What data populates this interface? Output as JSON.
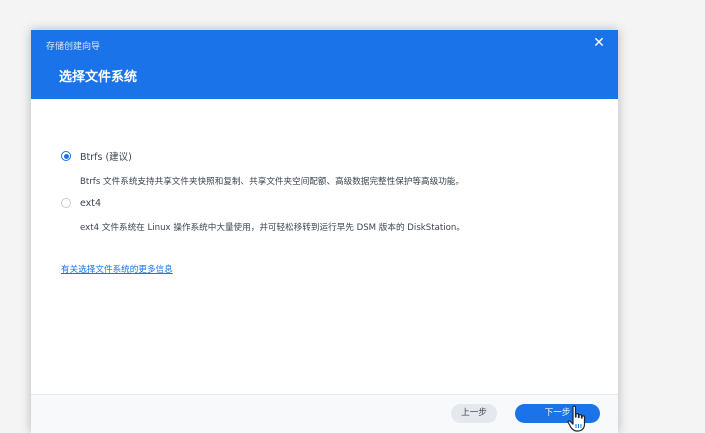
{
  "dialog": {
    "wizard_name": "存储创建向导",
    "title": "选择文件系统",
    "close_symbol": "✕"
  },
  "options": [
    {
      "label": "Btrfs (建议)",
      "checked": true,
      "description": "Btrfs 文件系统支持共享文件夹快照和复制、共享文件夹空间配额、高级数据完整性保护等高级功能。"
    },
    {
      "label": "ext4",
      "checked": false,
      "description": "ext4 文件系统在 Linux 操作系统中大量使用，并可轻松移转到运行早先 DSM 版本的 DiskStation。"
    }
  ],
  "more_info_link": "有关选择文件系统的更多信息",
  "footer": {
    "prev_label": "上一步",
    "next_label": "下一步"
  },
  "colors": {
    "accent": "#1a73e8",
    "text": "#3b4450"
  },
  "icons": {
    "close": "close-icon",
    "cursor": "hand-pointer-icon"
  }
}
